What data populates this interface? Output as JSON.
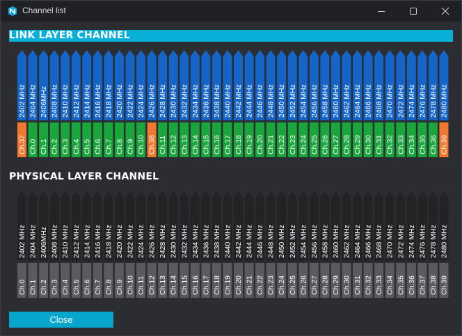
{
  "window": {
    "title": "Channel list",
    "controls": {
      "minimize": "minimize-icon",
      "maximize": "maximize-icon",
      "close": "close-icon"
    }
  },
  "link_layer": {
    "heading": "LINK LAYER CHANNEL",
    "colors": {
      "freq": "#1565c8",
      "data": "#1aa63c",
      "advertising": "#f07830"
    },
    "frequencies": [
      "2402 MHz",
      "2404 MHz",
      "2406MHz",
      "2408 MHz",
      "2410 MHz",
      "2412 MHz",
      "2414 MHz",
      "2416 MHz",
      "2418 MHz",
      "2420 MHz",
      "2422 MHz",
      "2424 MHz",
      "2426 MHz",
      "2428 MHz",
      "2430 MHz",
      "2432 MHz",
      "2434 MHz",
      "2436 MHz",
      "2438 MHz",
      "2440 MHz",
      "2442 MHz",
      "2444 MHz",
      "2446 MHz",
      "2448 MHz",
      "2450 MHz",
      "2452 MHz",
      "2454 MHz",
      "2456 MHz",
      "2458 MHz",
      "2460 MHz",
      "2462 MHz",
      "2464 MHz",
      "2466 MHz",
      "2468 MHz",
      "2470 MHz",
      "2472 MHz",
      "2474 MHz",
      "2476 MHz",
      "2478 MHz",
      "2480 MHz"
    ],
    "channels": [
      "Ch.37",
      "Ch.0",
      "Ch.1",
      "Ch.2",
      "Ch.3",
      "Ch.4",
      "Ch.5",
      "Ch.6",
      "Ch.7",
      "Ch.8",
      "Ch.9",
      "Ch.10",
      "Ch.38",
      "Ch.11",
      "Ch.12",
      "Ch.13",
      "Ch.14",
      "Ch.15",
      "Ch.16",
      "Ch.17",
      "Ch.18",
      "Ch.19",
      "Ch.20",
      "Ch.21",
      "Ch.22",
      "Ch.23",
      "Ch.24",
      "Ch.25",
      "Ch.26",
      "Ch.27",
      "Ch.28",
      "Ch.29",
      "Ch.30",
      "Ch.31",
      "Ch.32",
      "Ch.33",
      "Ch.34",
      "Ch.35",
      "Ch.36",
      "Ch.39"
    ]
  },
  "physical_layer": {
    "heading": "PHYSICAL LAYER CHANNEL",
    "colors": {
      "freq": "#222325",
      "channel": "#5a5b5e"
    },
    "frequencies": [
      "2402 MHz",
      "2404 MHz",
      "2406MHz",
      "2408 MHz",
      "2410 MHz",
      "2412 MHz",
      "2414 MHz",
      "2416 MHz",
      "2418 MHz",
      "2420 MHz",
      "2422 MHz",
      "2424 MHz",
      "2426 MHz",
      "2428 MHz",
      "2430 MHz",
      "2432 MHz",
      "2434 MHz",
      "2436 MHz",
      "2438 MHz",
      "2440 MHz",
      "2442 MHz",
      "2444 MHz",
      "2446 MHz",
      "2448 MHz",
      "2450 MHz",
      "2452 MHz",
      "2454 MHz",
      "2456 MHz",
      "2458 MHz",
      "2460 MHz",
      "2462 MHz",
      "2464 MHz",
      "2466 MHz",
      "2468 MHz",
      "2470 MHz",
      "2472 MHz",
      "2474 MHz",
      "2476 MHz",
      "2478 MHz",
      "2480 MHz"
    ],
    "channels": [
      "Ch.0",
      "Ch.1",
      "Ch.2",
      "Ch.3",
      "Ch.4",
      "Ch.5",
      "Ch.6",
      "Ch.7",
      "Ch.8",
      "Ch.9",
      "Ch.10",
      "Ch.11",
      "Ch.12",
      "Ch.13",
      "Ch.14",
      "Ch.15",
      "Ch.16",
      "Ch.17",
      "Ch.18",
      "Ch.19",
      "Ch.20",
      "Ch.21",
      "Ch.22",
      "Ch.23",
      "Ch.24",
      "Ch.25",
      "Ch.26",
      "Ch.27",
      "Ch.28",
      "Ch.29",
      "Ch.30",
      "Ch.31",
      "Ch.32",
      "Ch.33",
      "Ch.34",
      "Ch.35",
      "Ch.36",
      "Ch.37",
      "Ch.38",
      "Ch.39"
    ]
  },
  "close_button": {
    "label": "Close"
  }
}
